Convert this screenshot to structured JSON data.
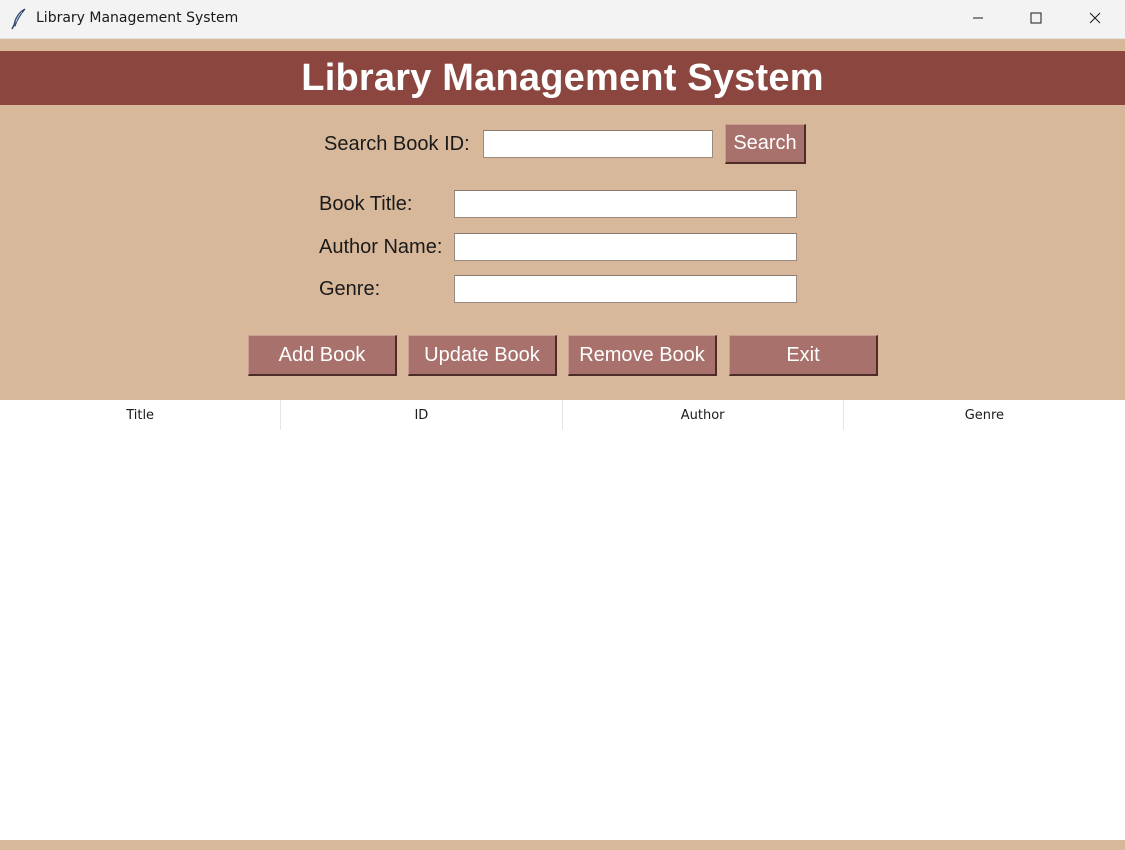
{
  "window": {
    "title": "Library Management System",
    "icon": "feather-icon",
    "controls": [
      "minimize-icon",
      "maximize-icon",
      "close-icon"
    ]
  },
  "header": {
    "title": "Library Management System"
  },
  "search": {
    "label": "Search Book ID:",
    "value": "",
    "button_label": "Search"
  },
  "form": {
    "title_label": "Book Title:",
    "title_value": "",
    "author_label": "Author Name:",
    "author_value": "",
    "genre_label": "Genre:",
    "genre_value": ""
  },
  "actions": {
    "add": "Add Book",
    "update": "Update Book",
    "remove": "Remove Book",
    "exit": "Exit"
  },
  "table": {
    "columns": [
      "Title",
      "ID",
      "Author",
      "Genre"
    ],
    "rows": []
  },
  "colors": {
    "background": "#d8b89a",
    "header_bar": "#8b4640",
    "button": "#a8716c"
  }
}
